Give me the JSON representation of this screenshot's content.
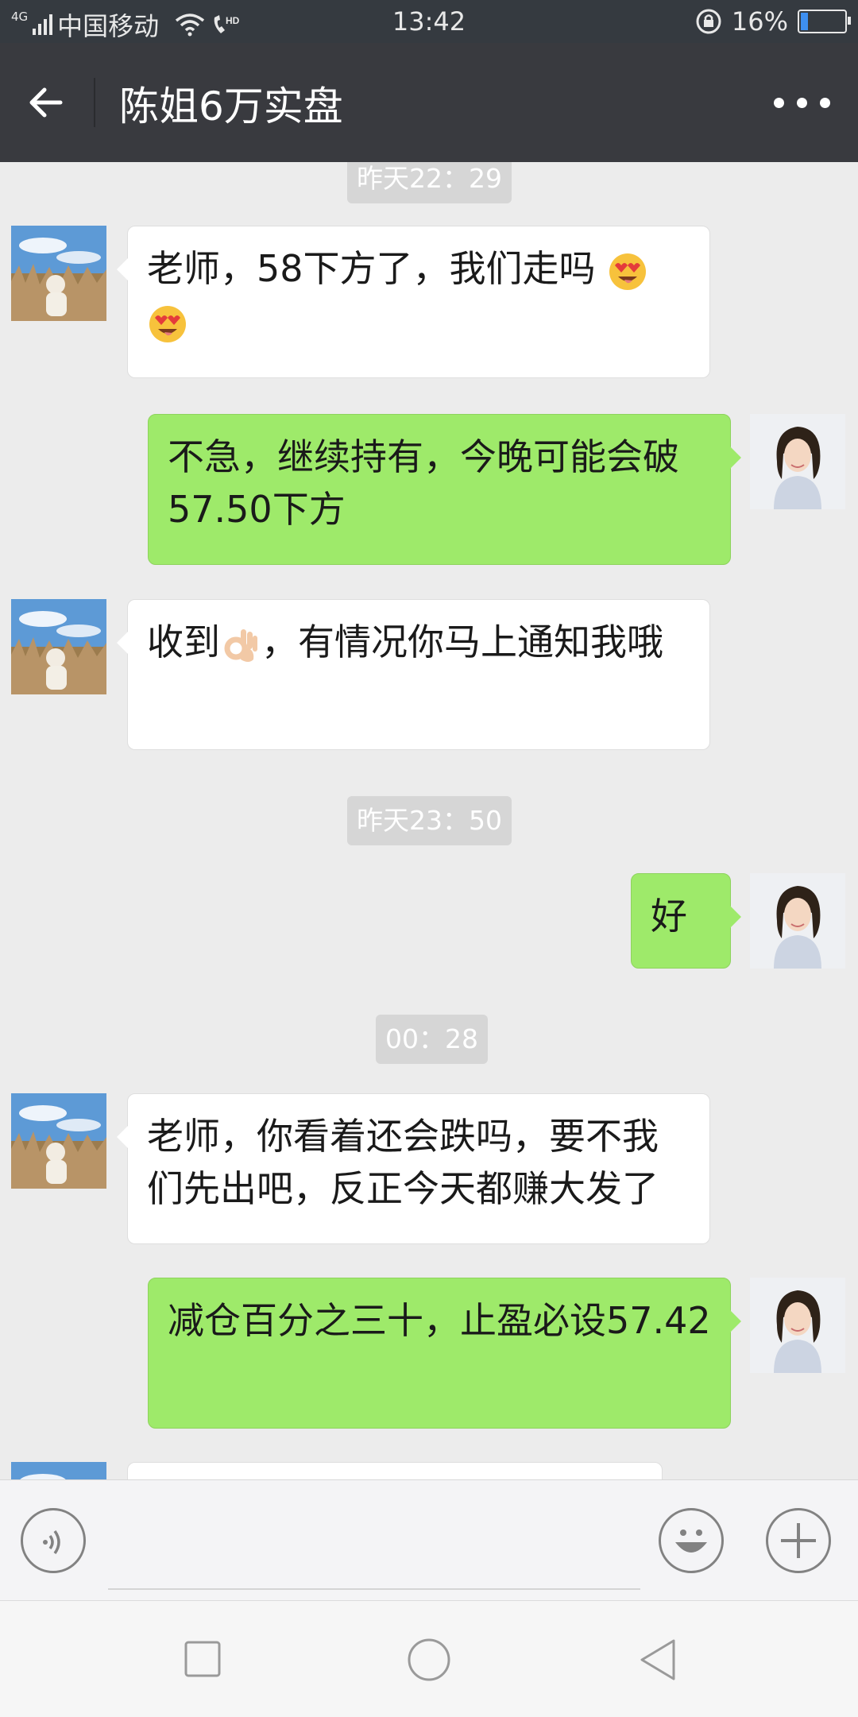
{
  "status_bar": {
    "network_tag": "4G",
    "carrier": "中国移动",
    "time": "13:42",
    "battery_percent": "16%",
    "battery_level": 0.16
  },
  "header": {
    "title": "陈姐6万实盘",
    "back_icon": "arrow-left-icon",
    "more_icon": "more-dots-icon"
  },
  "messages": {
    "ts0": "昨天22：29",
    "m1": "老师，58下方了，我们走吗",
    "m2": "不急，继续持有，今晚可能会破57.50下方",
    "m3a": "收到",
    "m3b": "，有情况你马上通知我哦",
    "ts1": "昨天23：50",
    "m4": "好",
    "ts2": "00：28",
    "m5": "老师，你看着还会跌吗，要不我们先出吧，反正今天都赚大发了",
    "m6": "减仓百分之三十，止盈必设57.42"
  },
  "colors": {
    "header_bg": "#393a3f",
    "chat_bg": "#ececec",
    "outgoing_bubble": "#9eea6a",
    "incoming_bubble": "#ffffff"
  },
  "input_bar": {
    "voice_icon": "voice-icon",
    "emoji_icon": "emoji-icon",
    "plus_icon": "plus-icon"
  }
}
